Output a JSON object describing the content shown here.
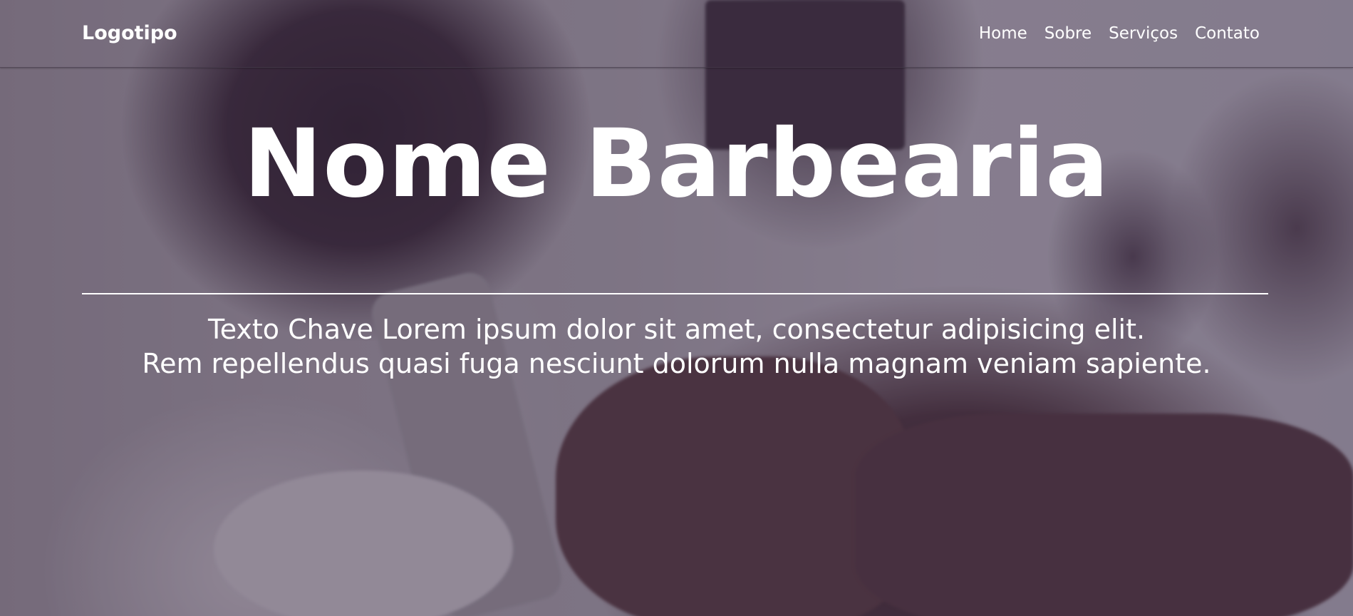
{
  "header": {
    "logo": "Logotipo",
    "nav": [
      {
        "label": "Home"
      },
      {
        "label": "Sobre"
      },
      {
        "label": "Serviços"
      },
      {
        "label": "Contato"
      }
    ]
  },
  "hero": {
    "title": "Nome Barbearia",
    "tagline_line1": "Texto Chave Lorem ipsum dolor sit amet, consectetur adipisicing elit.",
    "tagline_line2": "Rem repellendus quasi fuga nesciunt dolorum nulla magnam veniam sapiente."
  },
  "colors": {
    "text": "#ffffff",
    "overlay": "#37263c"
  }
}
